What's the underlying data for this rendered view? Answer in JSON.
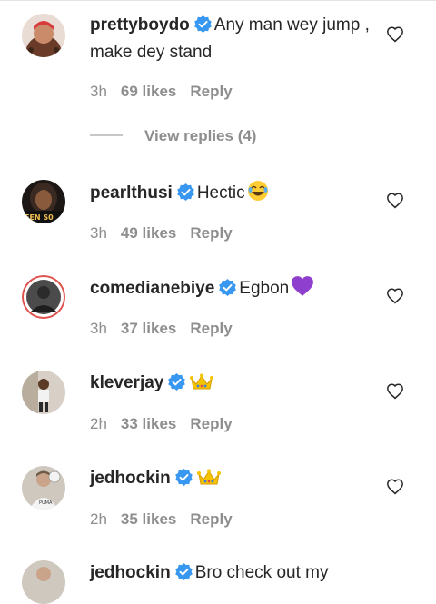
{
  "comments": [
    {
      "username": "prettyboydo",
      "text": "Any man wey jump , make dey stand",
      "time": "3h",
      "likes": "69 likes",
      "reply": "Reply",
      "emoji": "",
      "avatar": "avatar-prettyboydo"
    },
    {
      "username": "pearlthusi",
      "text": "Hectic",
      "time": "3h",
      "likes": "49 likes",
      "reply": "Reply",
      "emoji": "joy-emoji",
      "avatar_text": "EEN S0"
    },
    {
      "username": "comedianebiye",
      "text": "Egbon",
      "time": "3h",
      "likes": "37 likes",
      "reply": "Reply",
      "emoji": "purple-heart-emoji"
    },
    {
      "username": "kleverjay",
      "text": "",
      "time": "2h",
      "likes": "33 likes",
      "reply": "Reply",
      "emoji": "crown-emoji"
    },
    {
      "username": "jedhockin",
      "text": "",
      "time": "2h",
      "likes": "35 likes",
      "reply": "Reply",
      "emoji": "crown-emoji"
    },
    {
      "username": "jedhockin",
      "text": "Bro check out my"
    }
  ],
  "view_replies": "View replies (4)",
  "colors": {
    "verified": "#3897f0",
    "muted": "#8e8e8e",
    "text": "#262626"
  }
}
